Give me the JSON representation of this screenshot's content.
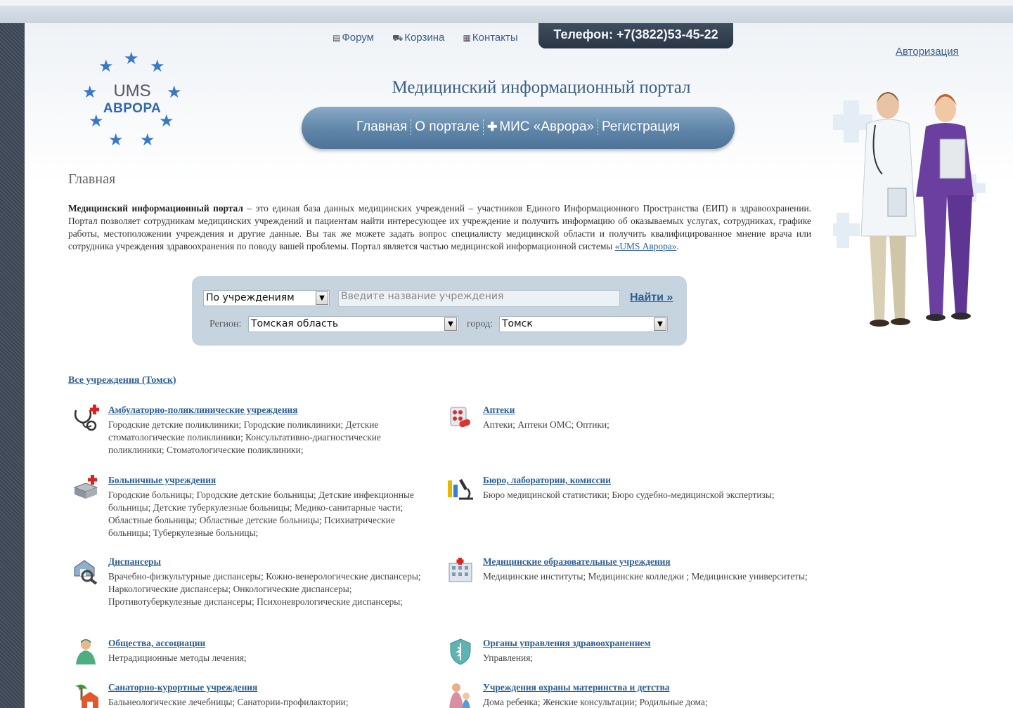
{
  "toplinks": {
    "forum": "Форум",
    "cart": "Корзина",
    "contacts": "Контакты"
  },
  "phone": "Телефон: +7(3822)53-45-22",
  "auth": "Авторизация",
  "logo": {
    "line1": "UMS",
    "line2": "АВРОРА"
  },
  "site_title": "Медицинский информационный портал",
  "nav": {
    "home": "Главная",
    "about": "О портале",
    "mis": "МИС «Аврора»",
    "register": "Регистрация"
  },
  "page_heading": "Главная",
  "intro": {
    "bold": "Медицинский информационный портал",
    "text": " – это единая база данных медицинских учреждений – участников Единого Информационного Пространства (ЕИП) в здравоохранении. Портал позволяет сотрудникам медицинских учреждений и пациентам найти интересующее их учреждение и получить информацию об оказываемых услугах, сотрудниках, графике работы, местоположении учреждения и другие данные. Вы так же можете задать вопрос специалисту медицинской области и получить квалифицированное мнение врача или сотрудника учреждения здравоохранения по поводу вашей проблемы. Портал является частью медицинской информационной системы ",
    "link": "«UMS Аврора»",
    "end": "."
  },
  "search": {
    "mode": "По учреждениям",
    "placeholder": "Введите название учреждения",
    "find": "Найти »",
    "region_label": "Регион:",
    "region": "Томская область",
    "city_label": "город:",
    "city": "Томск"
  },
  "all_link": "Все учреждения (Томск)",
  "categories": [
    {
      "title": "Амбулаторно-поликлинические учреждения",
      "desc": "Городские детские поликлиники; Городские поликлиники; Детские стоматологические поликлиники; Консультативно-диагностические поликлиники; Стоматологические поликлиники;",
      "icon": "stethoscope-icon"
    },
    {
      "title": "Аптеки",
      "desc": "Аптеки; Аптеки ОМС; Оптики;",
      "icon": "pills-icon"
    },
    {
      "title": "Больничные учреждения",
      "desc": "Городские больницы; Городские детские больницы; Детские инфекционные больницы; Детские туберкулезные больницы; Медико-санитарные части; Областные больницы; Областные детские больницы; Психиатрические больницы; Туберкулезные больницы;",
      "icon": "hospital-bed-icon"
    },
    {
      "title": "Бюро, лаборатории, комиссии",
      "desc": "Бюро медицинской статистики; Бюро судебно-медицинской экспертизы;",
      "icon": "microscope-icon"
    },
    {
      "title": "Диспансеры",
      "desc": "Врачебно-физкультурные диспансеры; Кожно-венерологические диспансеры; Наркологические диспансеры; Онкологические диспансеры; Противотуберкулезные диспансеры; Психоневрологические диспансеры;",
      "icon": "house-magnifier-icon"
    },
    {
      "title": "Медицинские образовательные учреждения",
      "desc": "Медицинские институты; Медицинские колледжи ; Медицинские университеты;",
      "icon": "building-icon"
    },
    {
      "title": "Общества, ассоциации",
      "desc": "Нетрадиционные методы лечения;",
      "icon": "doctor-icon"
    },
    {
      "title": "Органы управления здравоохранением",
      "desc": "Управления;",
      "icon": "medical-shield-icon"
    },
    {
      "title": "Санаторно-курортные учреждения",
      "desc": "Бальнеологические лечебницы; Санатории-профилактории;",
      "icon": "palm-house-icon"
    },
    {
      "title": "Учреждения охраны материнства и детства",
      "desc": "Дома ребенка; Женские консультации; Родильные дома;",
      "icon": "mother-child-icon"
    }
  ],
  "colors": {
    "accent": "#2b5e92",
    "nav": "#5f85a8",
    "phone_bg": "#2b3645"
  }
}
